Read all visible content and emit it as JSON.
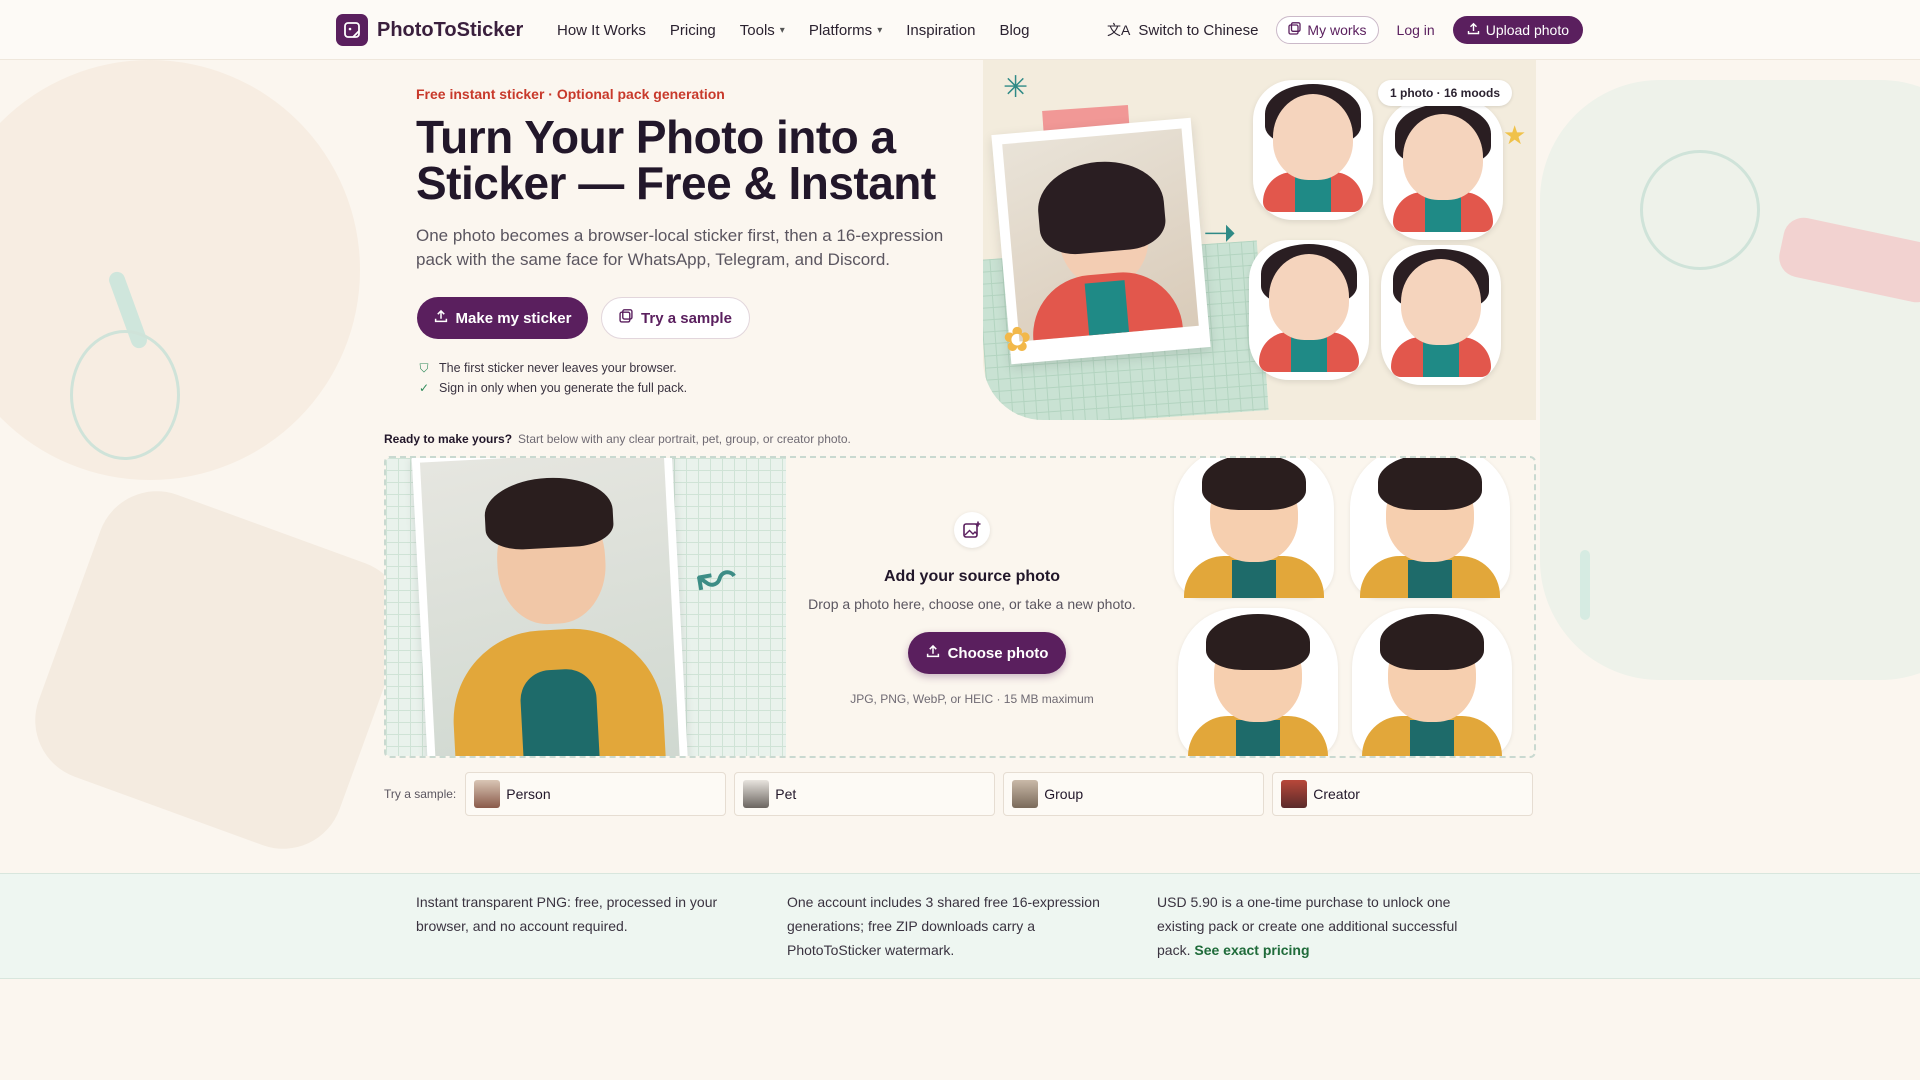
{
  "brand": {
    "name": "PhotoToSticker",
    "accent": "#5a1f5e"
  },
  "nav": {
    "items": [
      {
        "label": "How It Works",
        "dropdown": false
      },
      {
        "label": "Pricing",
        "dropdown": false
      },
      {
        "label": "Tools",
        "dropdown": true
      },
      {
        "label": "Platforms",
        "dropdown": true
      },
      {
        "label": "Inspiration",
        "dropdown": false
      },
      {
        "label": "Blog",
        "dropdown": false
      }
    ],
    "switch_language": "Switch to Chinese",
    "my_works": "My works",
    "login": "Log in",
    "upload": "Upload photo"
  },
  "hero": {
    "eyebrow": "Free instant sticker · Optional pack generation",
    "title": "Turn Your Photo into a Sticker — Free & Instant",
    "description": "One photo becomes a browser-local sticker first, then a 16-expression pack with the same face for WhatsApp, Telegram, and Discord.",
    "primary_button": "Make my sticker",
    "secondary_button": "Try a sample",
    "bullets": [
      "The first sticker never leaves your browser.",
      "Sign in only when you generate the full pack."
    ],
    "moods_badge": "1 photo · 16 moods"
  },
  "ready": {
    "bold": "Ready to make yours?",
    "text": "Start below with any clear portrait, pet, group, or creator photo."
  },
  "dropzone": {
    "title": "Add your source photo",
    "subtitle": "Drop a photo here, choose one, or take a new photo.",
    "button": "Choose photo",
    "hint": "JPG, PNG, WebP, or HEIC · 15 MB maximum"
  },
  "samples": {
    "label": "Try a sample:",
    "items": [
      "Person",
      "Pet",
      "Group",
      "Creator"
    ]
  },
  "info": {
    "col1": "Instant transparent PNG: free, processed in your browser, and no account required.",
    "col2": "One account includes 3 shared free 16-expression generations; free ZIP downloads carry a PhotoToSticker watermark.",
    "col3": "USD 5.90 is a one-time purchase to unlock one existing pack or create one additional successful pack.",
    "col3_link": "See exact pricing"
  }
}
